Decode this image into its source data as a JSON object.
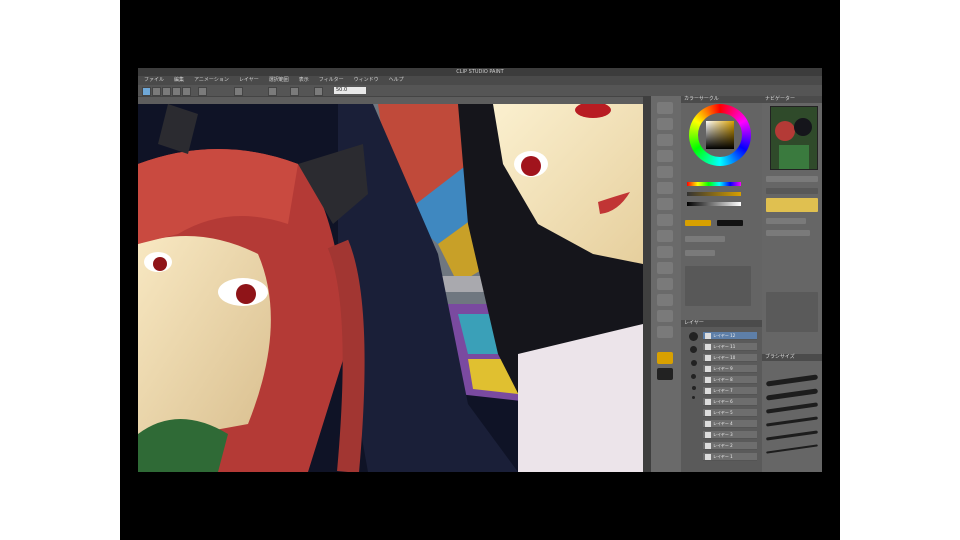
{
  "app": {
    "title": "CLIP STUDIO PAINT",
    "menu": [
      "ファイル",
      "編集",
      "アニメーション",
      "レイヤー",
      "選択範囲",
      "表示",
      "フィルター",
      "ウィンドウ",
      "ヘルプ"
    ],
    "zoom_field": "50.0"
  },
  "panels": {
    "color": {
      "label": "カラーサークル"
    },
    "navigator": {
      "label": "ナビゲーター"
    },
    "layers": {
      "label": "レイヤー",
      "items": [
        "レイヤー 12",
        "レイヤー 11",
        "レイヤー 10",
        "レイヤー 9",
        "レイヤー 8",
        "レイヤー 7",
        "レイヤー 6",
        "レイヤー 5",
        "レイヤー 4",
        "レイヤー 3",
        "レイヤー 2",
        "レイヤー 1"
      ]
    },
    "brush": {
      "label": "ブラシサイズ"
    }
  },
  "colors": {
    "hair_red": "#c3413c",
    "skin": "#f3e2b9",
    "dark_hair": "#15151b",
    "panel_bg": "#646464",
    "accent_yellow": "#d8a000"
  }
}
